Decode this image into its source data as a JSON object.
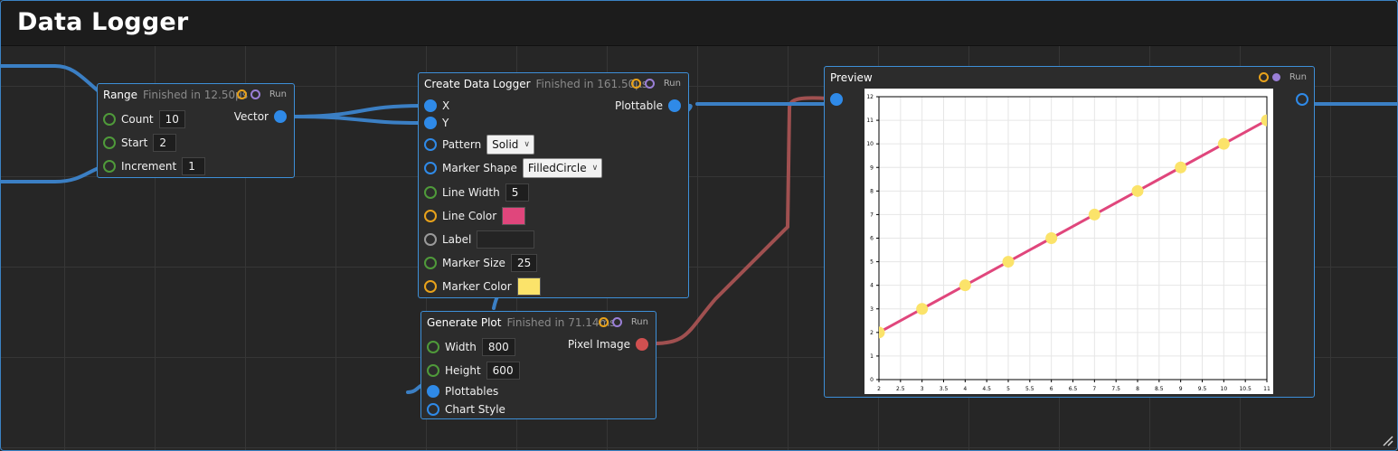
{
  "app": {
    "title": "Data Logger"
  },
  "nodes": {
    "range": {
      "title": "Range",
      "status": "Finished in 12.50µs",
      "run_label": "Run",
      "inputs": [
        {
          "label": "Count",
          "value": "10"
        },
        {
          "label": "Start",
          "value": "2"
        },
        {
          "label": "Increment",
          "value": "1"
        }
      ],
      "output": "Vector"
    },
    "create": {
      "title": "Create Data Logger",
      "status": "Finished in 161.50µs",
      "run_label": "Run",
      "inputs": {
        "x": "X",
        "y": "Y",
        "pattern": {
          "label": "Pattern",
          "value": "Solid"
        },
        "marker_shape": {
          "label": "Marker Shape",
          "value": "FilledCircle"
        },
        "line_width": {
          "label": "Line Width",
          "value": "5"
        },
        "line_color": {
          "label": "Line Color",
          "color": "#e0467c"
        },
        "label": {
          "label": "Label",
          "value": ""
        },
        "marker_size": {
          "label": "Marker Size",
          "value": "25"
        },
        "marker_color": {
          "label": "Marker Color",
          "color": "#fbe36a"
        }
      },
      "output": "Plottable"
    },
    "generate": {
      "title": "Generate Plot",
      "status": "Finished in 71.14ms",
      "run_label": "Run",
      "inputs": {
        "width": {
          "label": "Width",
          "value": "800"
        },
        "height": {
          "label": "Height",
          "value": "600"
        },
        "plottables": "Plottables",
        "chart_style": "Chart Style"
      },
      "output": "Pixel Image"
    },
    "preview": {
      "title": "Preview",
      "run_label": "Run"
    }
  },
  "colors": {
    "accent": "#3d8fd8",
    "wire_blue": "#3b7fc4",
    "wire_red": "#a05050",
    "line": "#e0467c",
    "marker": "#fbe36a"
  },
  "chart_data": {
    "type": "line",
    "x": [
      2,
      3,
      4,
      5,
      6,
      7,
      8,
      9,
      10,
      11
    ],
    "y": [
      2,
      3,
      4,
      5,
      6,
      7,
      8,
      9,
      10,
      11
    ],
    "xlim": [
      2,
      11
    ],
    "ylim": [
      0,
      12
    ],
    "x_ticks": [
      "2",
      "2.5",
      "3",
      "3.5",
      "4",
      "4.5",
      "5",
      "5.5",
      "6",
      "6.5",
      "7",
      "7.5",
      "8",
      "8.5",
      "9",
      "9.5",
      "10",
      "10.5",
      "11"
    ],
    "y_ticks": [
      "0",
      "1",
      "2",
      "3",
      "4",
      "5",
      "6",
      "7",
      "8",
      "9",
      "10",
      "11",
      "12"
    ],
    "grid": true
  }
}
